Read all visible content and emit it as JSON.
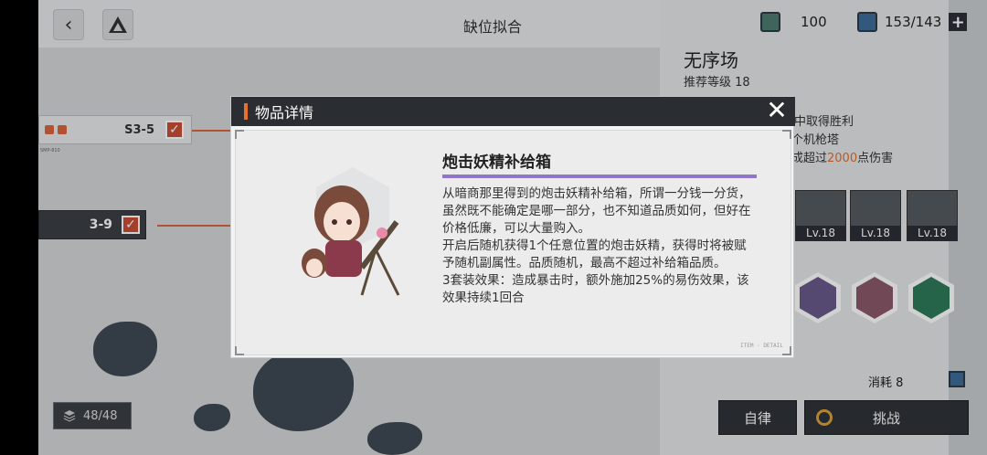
{
  "topbar": {
    "title": "缺位拟合",
    "back_icon": "chevron-left-icon",
    "map_icon": "triangle-logo-icon"
  },
  "stages": [
    {
      "label": "S3-5",
      "checked": true
    },
    {
      "label": "3-9",
      "checked": true
    }
  ],
  "stage_small_code": "SMP-810",
  "counter": {
    "value": "48/48",
    "icon": "layers-icon"
  },
  "resources": [
    {
      "value": "100",
      "icon": "ticket-icon"
    },
    {
      "value": "153/143",
      "icon": "map-card-icon"
    }
  ],
  "panel": {
    "title": "无序场",
    "recommended_level": "推荐等级 18",
    "conditions": [
      "战中取得胜利",
      "个机枪塔",
      "成超过",
      "2000",
      "点伤害"
    ],
    "units": [
      {
        "level": "Lv.18"
      },
      {
        "level": "Lv.18"
      },
      {
        "level": "Lv.18"
      }
    ],
    "consume": "消耗 8",
    "buttons": {
      "auto": "自律",
      "challenge": "挑战"
    }
  },
  "modal": {
    "header": "物品详情",
    "item_name": "炮击妖精补给箱",
    "description": [
      "从暗商那里得到的炮击妖精补给箱，所谓一分钱一分货，虽然既不能确定是哪一部分，也不知道品质如何，但好在价格低廉，可以大量购入。",
      "开启后随机获得1个任意位置的炮击妖精，获得时将被赋予随机副属性。品质随机，最高不超过补给箱品质。",
      "3套装效果：造成暴击时，额外施加25%的易伤效果，该效果持续1回合"
    ],
    "footer_tag": "ITEM · DETAIL"
  },
  "colors": {
    "accent": "#e8702e",
    "purple": "#8f76c9",
    "check_red": "#c84e35"
  }
}
